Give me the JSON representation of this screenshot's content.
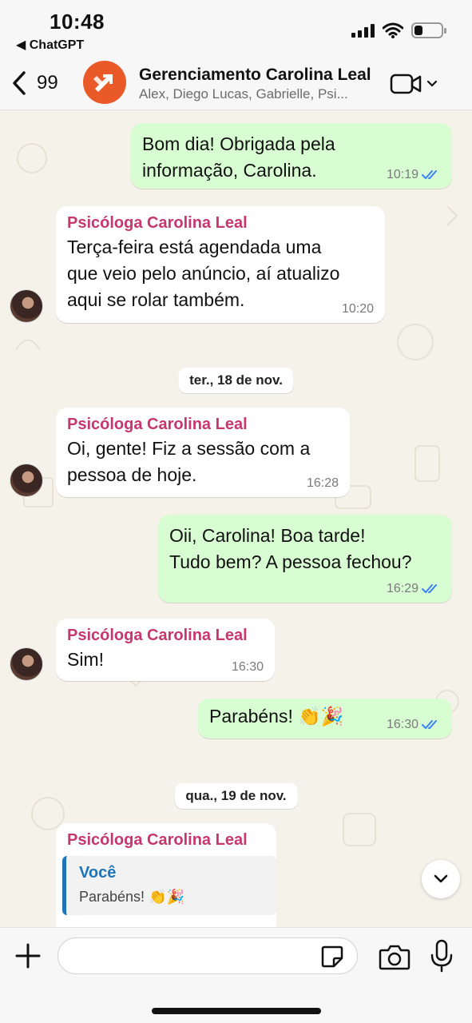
{
  "status_bar": {
    "time": "10:48",
    "back_app": "◀ ChatGPT",
    "battery_level": 0.3
  },
  "header": {
    "back_count": "99",
    "title": "Gerenciamento Carolina Leal",
    "members": "Alex, Diego Lucas, Gabrielle, Psi..."
  },
  "messages": [
    {
      "direction": "out",
      "text": "Bom dia! Obrigada pela\ninformação, Carolina.",
      "time": "10:19",
      "read": true
    },
    {
      "direction": "in",
      "sender": "Psicóloga Carolina Leal",
      "text": "Terça-feira está agendada uma\nque veio pelo anúncio, aí atualizo\naqui se rolar também.",
      "time": "10:20"
    },
    {
      "direction": "in",
      "sender": "Psicóloga Carolina Leal",
      "text": "Oi, gente! Fiz a sessão com a\npessoa de hoje.",
      "time": "16:28"
    },
    {
      "direction": "out",
      "text": "Oii, Carolina! Boa tarde!\nTudo bem? A pessoa fechou?",
      "time": "16:29",
      "read": true
    },
    {
      "direction": "in",
      "sender": "Psicóloga Carolina Leal",
      "text": "Sim!",
      "time": "16:30"
    },
    {
      "direction": "out",
      "text": "Parabéns! 👏🎉",
      "time": "16:30",
      "read": true
    },
    {
      "direction": "in",
      "sender": "Psicóloga Carolina Leal",
      "quote_author": "Você",
      "quote_text": "Parabéns! 👏🎉"
    }
  ],
  "date_separators": [
    "ter., 18 de nov.",
    "qua., 19 de nov."
  ],
  "composer": {
    "placeholder": "",
    "value": ""
  },
  "icons": {
    "back": "chevron-left-icon",
    "video": "video-camera-icon",
    "plus": "plus-icon",
    "sticker": "sticker-icon",
    "camera": "camera-icon",
    "mic": "microphone-icon",
    "scroll": "chevron-down-icon"
  },
  "colors": {
    "outgoing_bubble": "#d9fdd3",
    "incoming_bubble": "#ffffff",
    "sender_name": "#c7366f",
    "read_ticks": "#3b82f6",
    "group_avatar": "#ea5a28",
    "quote_accent": "#1f74b7"
  }
}
